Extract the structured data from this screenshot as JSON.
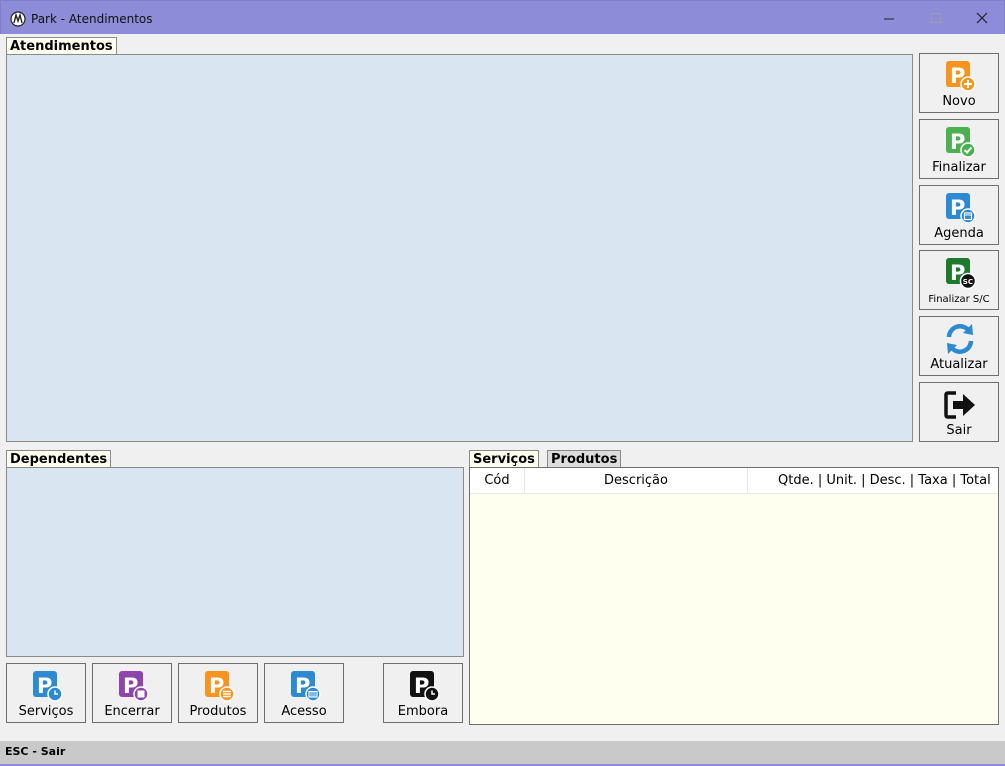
{
  "window": {
    "title": "Park - Atendimentos",
    "controls": [
      "minimize-icon",
      "maximize-icon",
      "close-icon"
    ],
    "titlebar_color": "#8c8cd8"
  },
  "atendimentos": {
    "label": "Atendimentos"
  },
  "dependentes": {
    "label": "Dependentes"
  },
  "side_buttons": [
    {
      "label": "Novo",
      "icon": "park-add-icon",
      "color": "#f7941d"
    },
    {
      "label": "Finalizar",
      "icon": "park-check-icon",
      "color": "#4caf50"
    },
    {
      "label": "Agenda",
      "icon": "park-calendar-icon",
      "color": "#2b8ad2"
    },
    {
      "label": "Finalizar S/C",
      "icon": "park-sc-icon",
      "color": "#1b7a2b"
    },
    {
      "label": "Atualizar",
      "icon": "refresh-icon",
      "color": "#2b8ad2"
    },
    {
      "label": "Sair",
      "icon": "exit-arrow-icon",
      "color": "#000000"
    }
  ],
  "bottom_buttons": [
    {
      "label": "Serviços",
      "icon": "park-clock-icon",
      "color": "#2b8ad2"
    },
    {
      "label": "Encerrar",
      "icon": "park-stop-icon",
      "color": "#8e44ad"
    },
    {
      "label": "Produtos",
      "icon": "park-list-icon",
      "color": "#f7941d"
    },
    {
      "label": "Acesso",
      "icon": "park-keyboard-icon",
      "color": "#2b8ad2"
    },
    {
      "label": "Embora",
      "icon": "park-leave-icon",
      "color": "#111111"
    }
  ],
  "tabs": [
    {
      "label": "Serviços",
      "active": true
    },
    {
      "label": "Produtos",
      "active": false
    }
  ],
  "grid": {
    "columns": [
      "Cód",
      "Descrição",
      "Qtde. | Unit. | Desc. | Taxa | Total"
    ],
    "rows": []
  },
  "status": {
    "text": "ESC - Sair"
  }
}
